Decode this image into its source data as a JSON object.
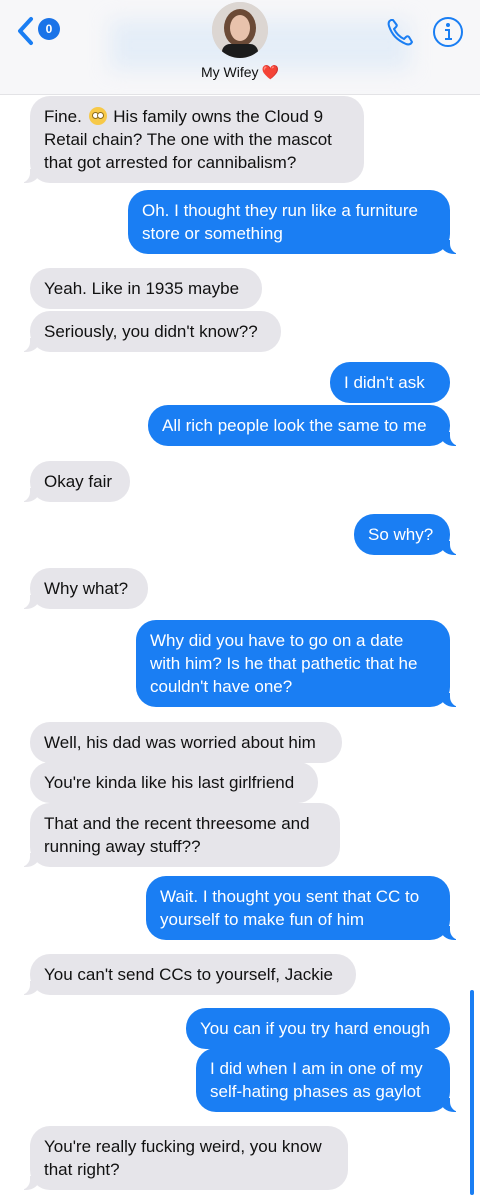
{
  "header": {
    "unread_count": "0",
    "contact_name": "My Wifey",
    "heart": "❤️",
    "icons": [
      "back-chevron-icon",
      "avatar",
      "phone-icon",
      "info-icon"
    ],
    "accent_color": "#1a7ef3"
  },
  "messages": [
    {
      "side": "in",
      "text_before": "Fine.",
      "emoji": "face-with-rolling-eyes",
      "text_after": "His family owns the Cloud 9 Retail chain? The one with the mascot that got arrested for cannibalism?"
    },
    {
      "side": "out",
      "text": "Oh. I thought  they run like a furniture store or something"
    },
    {
      "side": "in",
      "text": "Yeah. Like in 1935 maybe"
    },
    {
      "side": "in",
      "text": "Seriously, you didn't know??"
    },
    {
      "side": "out",
      "text": "I didn't ask"
    },
    {
      "side": "out",
      "text": "All rich people look the same to me"
    },
    {
      "side": "in",
      "text": "Okay fair"
    },
    {
      "side": "out",
      "text": "So why?"
    },
    {
      "side": "in",
      "text": "Why what?"
    },
    {
      "side": "out",
      "text": "Why did you have to go on a date with him? Is he that pathetic that he couldn't have one?"
    },
    {
      "side": "in",
      "text": "Well, his dad was worried about him"
    },
    {
      "side": "in",
      "text": "You're kinda like his last girlfriend"
    },
    {
      "side": "in",
      "text": "That and the recent threesome and running away stuff??"
    },
    {
      "side": "out",
      "text": "Wait. I thought you sent that CC to yourself to make fun of him"
    },
    {
      "side": "in",
      "text": "You can't send CCs to yourself, Jackie"
    },
    {
      "side": "out",
      "text": "You can if you try hard enough"
    },
    {
      "side": "out",
      "text": "I did when I am in one of my self-hating phases as gaylot"
    },
    {
      "side": "in",
      "text": "You're really fucking weird, you know that right?"
    }
  ]
}
